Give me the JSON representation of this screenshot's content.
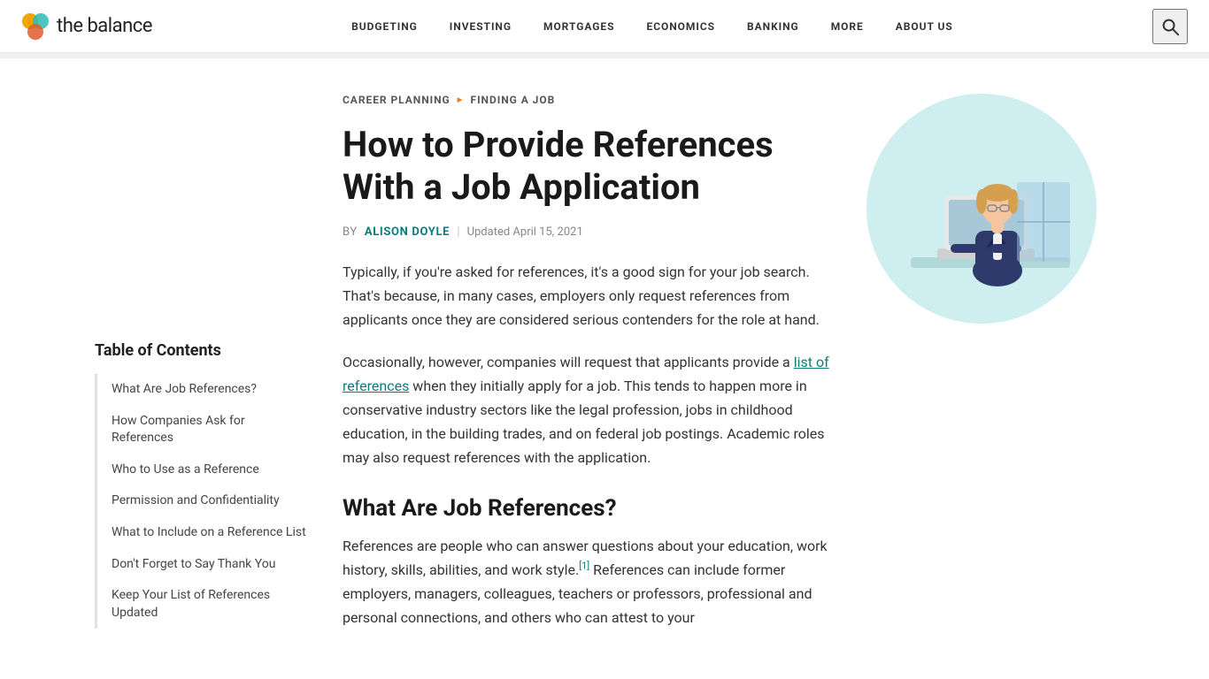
{
  "header": {
    "logo_text": "the balance",
    "nav_items": [
      "BUDGETING",
      "INVESTING",
      "MORTGAGES",
      "ECONOMICS",
      "BANKING",
      "MORE",
      "ABOUT US"
    ]
  },
  "breadcrumb": {
    "parent": "CAREER PLANNING",
    "current": "FINDING A JOB"
  },
  "article": {
    "title": "How to Provide References With a Job Application",
    "byline_prefix": "BY",
    "author": "ALISON DOYLE",
    "date_prefix": "Updated",
    "date": "April 15, 2021",
    "intro_p1": "Typically, if you're asked for references, it's a good sign for your job search. That's because, in many cases, employers only request references from applicants once they are considered serious contenders for the role at hand.",
    "intro_p2_start": "Occasionally, however, companies will request that applicants provide a ",
    "intro_p2_link": "list of references",
    "intro_p2_end": " when they initially apply for a job. This tends to happen more in conservative industry sectors like the legal profession, jobs in childhood education, in the building trades, and on federal job postings. Academic roles may also request references with the application.",
    "section1_title": "What Are Job References?",
    "section1_p1": "References are people who can answer questions about your education, work history, skills, abilities, and work style.",
    "section1_p1_sup": "1",
    "section1_p1_end": " References can include former employers, managers, colleagues, teachers or professors, professional and personal connections, and others who can attest to your"
  },
  "toc": {
    "title": "Table of Contents",
    "items": [
      "What Are Job References?",
      "How Companies Ask for References",
      "Who to Use as a Reference",
      "Permission and Confidentiality",
      "What to Include on a Reference List",
      "Don't Forget to Say Thank You",
      "Keep Your List of References Updated"
    ]
  }
}
